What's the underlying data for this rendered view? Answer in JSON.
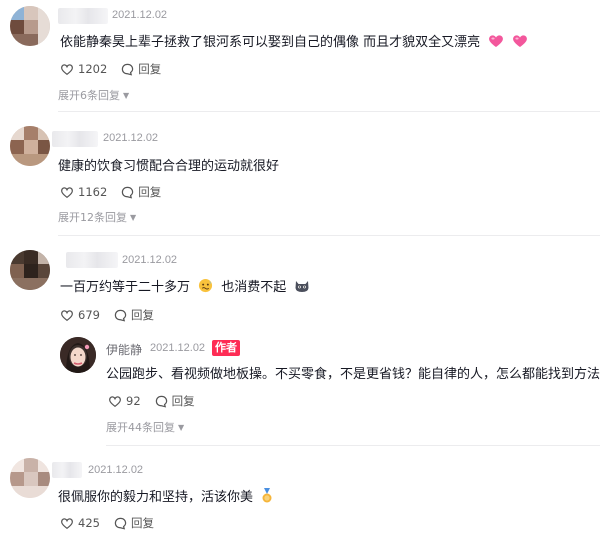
{
  "comments": [
    {
      "date": "2021.12.02",
      "text": "依能静秦昊上辈子拯救了银河系可以娶到自己的偶像 而且才貌双全又漂亮",
      "emojis": [
        "pink-heart-icon",
        "pink-heart-icon"
      ],
      "likes": "1202",
      "reply_label": "回复",
      "expand_label": "展开6条回复"
    },
    {
      "date": "2021.12.02",
      "text": "健康的饮食习惯配合合理的运动就很好",
      "likes": "1162",
      "reply_label": "回复",
      "expand_label": "展开12条回复"
    },
    {
      "date": "2021.12.02",
      "text": "一百万约等于二十多万",
      "text_suffix": "也消费不起",
      "emojis": [
        "nervous-face-icon",
        "cat-face-icon"
      ],
      "likes": "679",
      "reply_label": "回复",
      "reply": {
        "author": "伊能静",
        "date": "2021.12.02",
        "badge": "作者",
        "text": "公园跑步、看视频做地板操。不买零食，不是更省钱？能自律的人，怎么都能找到方法。",
        "likes": "92",
        "reply_label": "回复",
        "expand_label": "展开44条回复"
      }
    },
    {
      "date": "2021.12.02",
      "text": "很佩服你的毅力和坚持，活该你美",
      "emojis": [
        "medal-icon"
      ],
      "likes": "425",
      "reply_label": "回复"
    }
  ],
  "colors": {
    "accent": "#fe2c55",
    "muted": "#9a9aa0",
    "text": "#161823"
  }
}
